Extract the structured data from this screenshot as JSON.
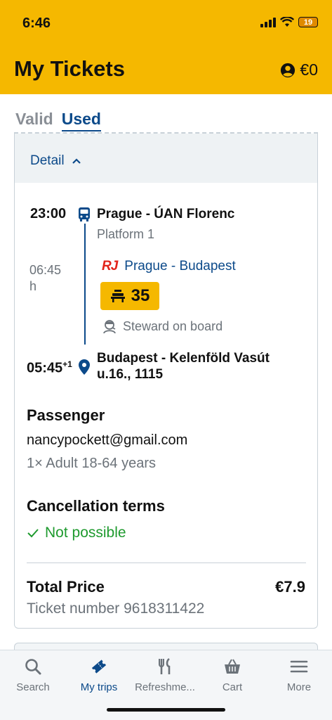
{
  "status": {
    "time": "6:46",
    "battery": "19"
  },
  "header": {
    "title": "My Tickets",
    "balance": "€0"
  },
  "tabs": [
    {
      "label": "Valid"
    },
    {
      "label": "Used"
    }
  ],
  "detail": {
    "label": "Detail"
  },
  "journey": {
    "departure": {
      "time": "23:00",
      "station": "Prague - ÚAN Florenc",
      "platform": "Platform 1"
    },
    "duration_value": "06:45",
    "duration_unit": "h",
    "operator_logo": "RJ",
    "route": "Prague - Budapest",
    "seat": "35",
    "service": "Steward on board",
    "arrival": {
      "time": "05:45",
      "day_offset": "+1",
      "station_line1": "Budapest - Kelenföld Vasút",
      "station_line2": "u.16., 1115"
    }
  },
  "passenger": {
    "title": "Passenger",
    "email": "nancypockett@gmail.com",
    "type": "1× Adult 18-64 years"
  },
  "cancellation": {
    "title": "Cancellation terms",
    "status": "Not possible"
  },
  "total": {
    "label": "Total Price",
    "value": "€7.9",
    "ticket_number": "Ticket number 9618311422"
  },
  "tabbar": [
    {
      "label": "Search",
      "icon": "search-icon"
    },
    {
      "label": "My trips",
      "icon": "ticket-icon"
    },
    {
      "label": "Refreshme...",
      "icon": "cutlery-icon"
    },
    {
      "label": "Cart",
      "icon": "basket-icon"
    },
    {
      "label": "More",
      "icon": "menu-icon"
    }
  ],
  "colors": {
    "brand": "#f5b800",
    "primary": "#0c4a8a",
    "success": "#1e9a2e",
    "muted": "#6b7279"
  }
}
